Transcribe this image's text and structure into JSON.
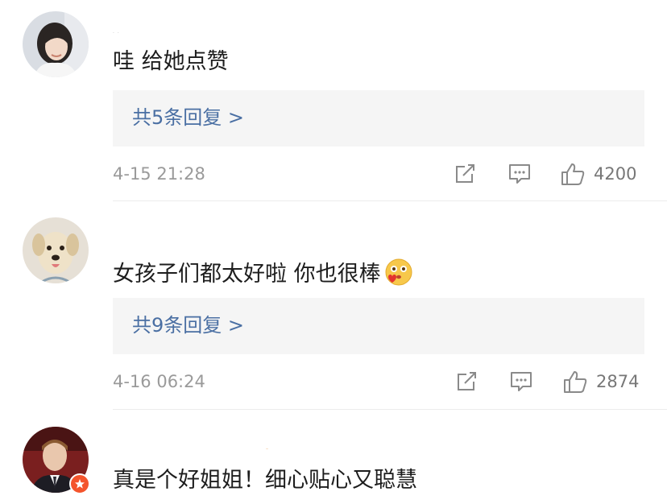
{
  "comments": [
    {
      "username": "· ·",
      "text": "哇 给她点赞",
      "reply_link": "共5条回复 >",
      "time": "4-15 21:28",
      "likes": "4200",
      "avatar_icon": "woman-portrait-avatar"
    },
    {
      "username": "",
      "text": "女孩子们都太好啦 你也很棒",
      "emoji_icon": "blush-kiss-emoji",
      "reply_link": "共9条回复 >",
      "time": "4-16 06:24",
      "likes": "2874",
      "avatar_icon": "dog-avatar"
    },
    {
      "username": "–",
      "text": "真是个好姐姐！细心贴心又聪慧",
      "avatar_icon": "man-in-suit-avatar",
      "badge_color": "#f4542c"
    }
  ],
  "colors": {
    "link": "#4a6fa3",
    "reply_bg": "#f5f5f5",
    "meta_text": "#9a9a9a",
    "icon_stroke": "#8a8a8a"
  }
}
